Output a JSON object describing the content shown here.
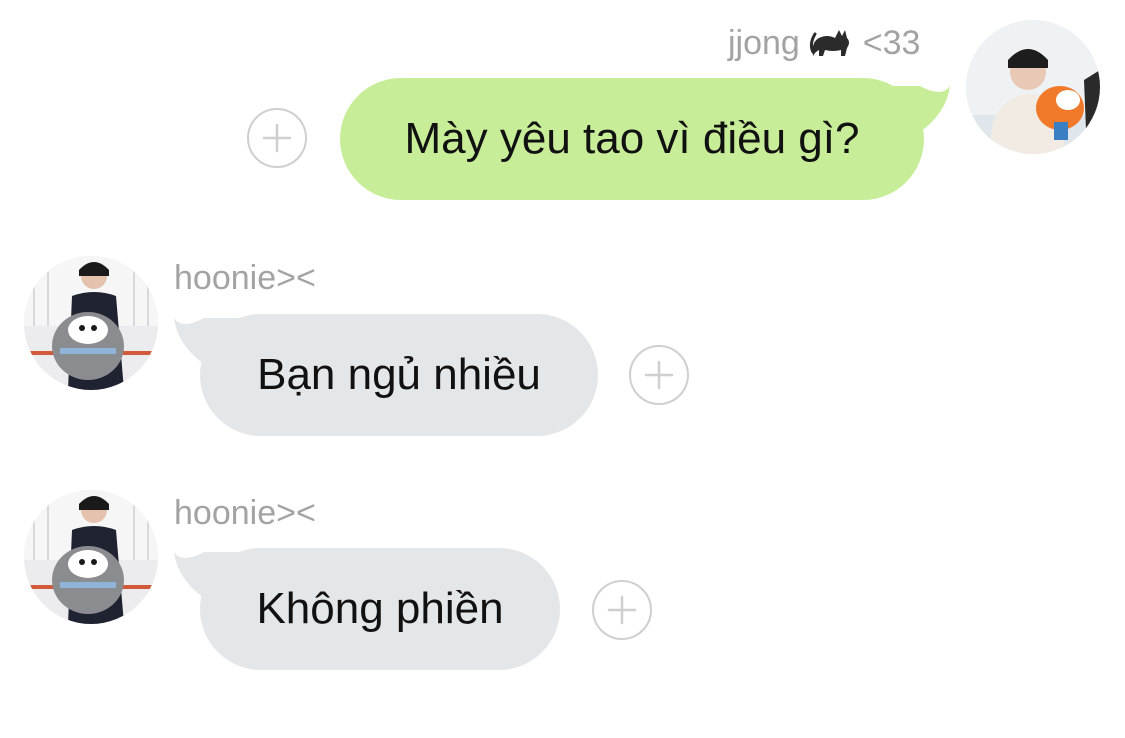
{
  "messages": [
    {
      "sender": "jjong",
      "sender_suffix": "<33",
      "sender_emoji": "cat-icon",
      "text": "Mày yêu tao vì điều gì?",
      "direction": "sent"
    },
    {
      "sender": "hoonie><",
      "text": "Bạn ngủ nhiều",
      "direction": "received"
    },
    {
      "sender": "hoonie><",
      "text": "Không phiền",
      "direction": "received"
    }
  ],
  "colors": {
    "sent_bubble": "#c7ed98",
    "received_bubble": "#e3e7ea",
    "name_text": "#a3a3a3",
    "add_button_border": "#cfcfcf"
  },
  "icons": {
    "add": "plus-circle-icon",
    "emoji": "cat-icon"
  }
}
